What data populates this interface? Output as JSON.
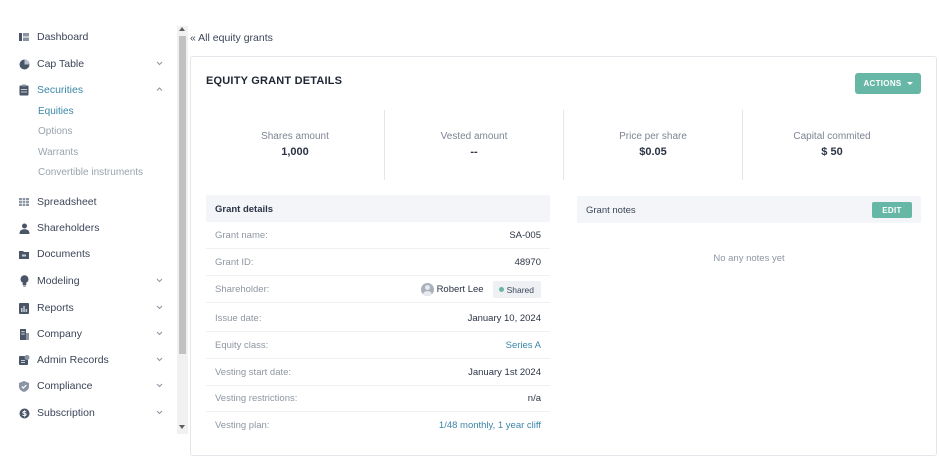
{
  "sidebar": {
    "items": [
      {
        "label": "Dashboard",
        "icon": "dashboard-icon",
        "expandable": false
      },
      {
        "label": "Cap Table",
        "icon": "pie-chart-icon",
        "expandable": true
      },
      {
        "label": "Securities",
        "icon": "clipboard-icon",
        "expandable": true,
        "expanded": true,
        "active": true
      },
      {
        "label": "Spreadsheet",
        "icon": "spreadsheet-icon",
        "expandable": false
      },
      {
        "label": "Shareholders",
        "icon": "user-icon",
        "expandable": false
      },
      {
        "label": "Documents",
        "icon": "folder-icon",
        "expandable": false
      },
      {
        "label": "Modeling",
        "icon": "lightbulb-icon",
        "expandable": true
      },
      {
        "label": "Reports",
        "icon": "report-icon",
        "expandable": true
      },
      {
        "label": "Company",
        "icon": "building-icon",
        "expandable": true
      },
      {
        "label": "Admin Records",
        "icon": "admin-records-icon",
        "expandable": true
      },
      {
        "label": "Compliance",
        "icon": "shield-check-icon",
        "expandable": true
      },
      {
        "label": "Subscription",
        "icon": "dollar-icon",
        "expandable": true
      }
    ],
    "securities_sub": [
      "Equities",
      "Options",
      "Warrants",
      "Convertible instruments"
    ]
  },
  "back_link": "« All equity grants",
  "card": {
    "title": "EQUITY GRANT DETAILS",
    "actions_label": "ACTIONS"
  },
  "stats": [
    {
      "label": "Shares amount",
      "value": "1,000"
    },
    {
      "label": "Vested amount",
      "value": "--"
    },
    {
      "label": "Price per share",
      "value": "$0.05"
    },
    {
      "label": "Capital commited",
      "value": "$ 50"
    }
  ],
  "grant_details": {
    "heading": "Grant details",
    "rows": [
      {
        "label": "Grant name:",
        "value": "SA-005"
      },
      {
        "label": "Grant ID:",
        "value": "48970"
      },
      {
        "label": "Shareholder:",
        "value": "Robert Lee",
        "badge": "Shared"
      },
      {
        "label": "Issue date:",
        "value": "January 10, 2024"
      },
      {
        "label": "Equity class:",
        "value": "Series A",
        "link": true
      },
      {
        "label": "Vesting start date:",
        "value": "January 1st 2024"
      },
      {
        "label": "Vesting restrictions:",
        "value": "n/a"
      },
      {
        "label": "Vesting plan:",
        "value": "1/48 monthly, 1 year cliff",
        "link": true
      }
    ]
  },
  "grant_notes": {
    "heading": "Grant notes",
    "edit_label": "EDIT",
    "empty_text": "No any notes yet"
  },
  "colors": {
    "accent": "#67b7a7",
    "link": "#3a86a8",
    "panel_bg": "#f3f5f8"
  }
}
